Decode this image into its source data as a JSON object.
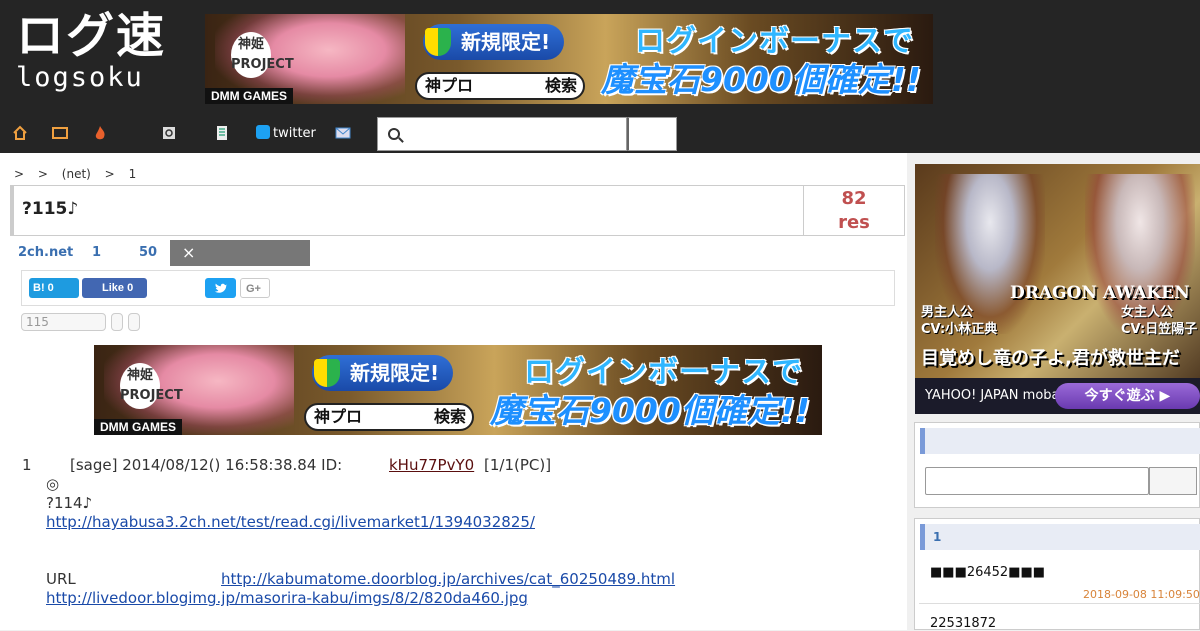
{
  "site": {
    "logo_jp": "ログ速",
    "logo_en": "logsoku"
  },
  "ad_banner": {
    "brand": "神姫 PROJECT",
    "dmm": "DMM GAMES",
    "new_only": "新規限定!",
    "search_word": "神プロ",
    "search_label": "検索",
    "headline": "ログインボーナスで",
    "subline": "魔宝石9000個確定!!"
  },
  "nav": {
    "twitter_label": "twitter",
    "icons": [
      "home-icon",
      "tv-icon",
      "fire-icon",
      "search-history-icon",
      "list-icon",
      "twitter-icon",
      "mail-icon"
    ]
  },
  "search": {
    "placeholder": ""
  },
  "breadcrumb": [
    ">",
    ">",
    "(net)",
    ">",
    "1"
  ],
  "thread": {
    "title": "?115♪",
    "res_count": "82",
    "res_label": "res"
  },
  "thread_links": {
    "source": "2ch.net",
    "first": "1",
    "last50": "50",
    "close": "×"
  },
  "share": {
    "hatena": "B! 0",
    "facebook": "Like 0",
    "gplus": "G+"
  },
  "pills": [
    "115",
    "",
    ""
  ],
  "post": {
    "number": "1",
    "meta": "[sage] 2014/08/12() 16:58:38.84 ID:",
    "id": "kHu77PvY0",
    "after_id": "[1/1(PC)]",
    "line1": "◎",
    "line2": "?114♪",
    "link1": "http://hayabusa3.2ch.net/test/read.cgi/livemarket1/1394032825/",
    "url_label": "URL",
    "link2": "http://kabumatome.doorblog.jp/archives/cat_60250489.html",
    "link3": "http://livedoor.blogimg.jp/masorira-kabu/imgs/8/2/820da460.jpg"
  },
  "side_ad": {
    "title": "DRAGON AWAKEN",
    "cv1_role": "男主人公",
    "cv1": "CV:小林正典",
    "cv2_role": "女主人公",
    "cv2": "CV:日笠陽子",
    "catch": "目覚めし竜の子よ,君が救世主だ",
    "footer": "YAHOO! JAPAN mobage",
    "play": "今すぐ遊ぶ ▶"
  },
  "sidebar": {
    "ranking_header": "1",
    "item1": "■■■26452■■■",
    "item1_date": "2018-09-08 11:09:50",
    "item2": "22531872"
  },
  "colors": {
    "header_bg": "#252525",
    "res_count": "#c05050",
    "link": "#1a4aa8",
    "date": "#d8843a"
  }
}
